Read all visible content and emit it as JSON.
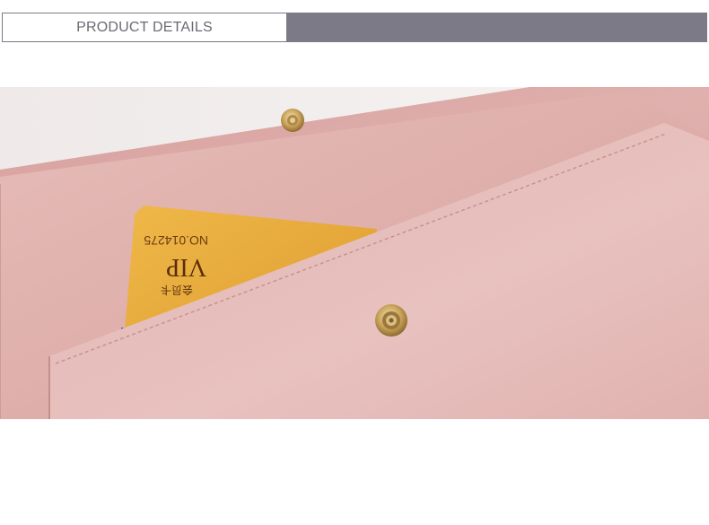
{
  "header": {
    "title": "PRODUCT DETAILS",
    "band_color": "#7b7a86"
  },
  "photo": {
    "subject": "pink-leather-wallet-with-card",
    "card": {
      "number_text": "NO.014275",
      "label_text": "VIP",
      "subtext": "会员卡"
    },
    "colors": {
      "leather": "#d9a9a6",
      "card_gold": "#e8a93a",
      "card_blue": "#2d4f9e"
    }
  }
}
